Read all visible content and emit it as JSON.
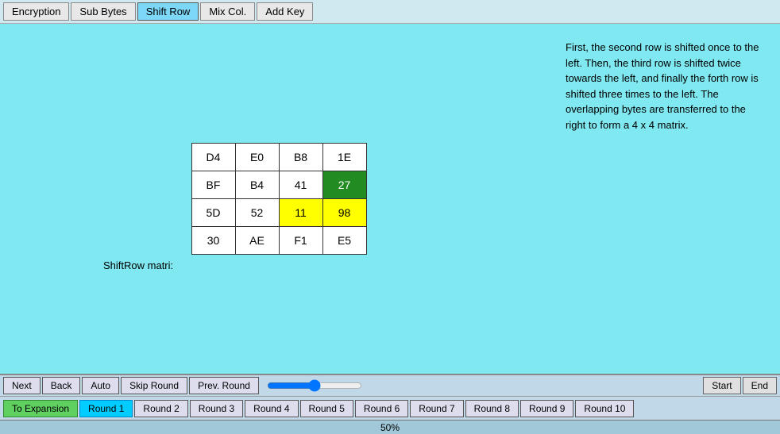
{
  "tabs": [
    {
      "label": "Encryption",
      "active": false
    },
    {
      "label": "Sub Bytes",
      "active": false
    },
    {
      "label": "Shift Row",
      "active": true
    },
    {
      "label": "Mix Col.",
      "active": false
    },
    {
      "label": "Add Key",
      "active": false
    }
  ],
  "matrix": {
    "rows": [
      [
        {
          "val": "D4",
          "style": ""
        },
        {
          "val": "E0",
          "style": ""
        },
        {
          "val": "B8",
          "style": ""
        },
        {
          "val": "1E",
          "style": ""
        }
      ],
      [
        {
          "val": "BF",
          "style": ""
        },
        {
          "val": "B4",
          "style": ""
        },
        {
          "val": "41",
          "style": ""
        },
        {
          "val": "27",
          "style": "cell-green-dark"
        }
      ],
      [
        {
          "val": "5D",
          "style": ""
        },
        {
          "val": "52",
          "style": ""
        },
        {
          "val": "11",
          "style": "cell-yellow"
        },
        {
          "val": "98",
          "style": "cell-yellow2"
        }
      ],
      [
        {
          "val": "30",
          "style": ""
        },
        {
          "val": "AE",
          "style": ""
        },
        {
          "val": "F1",
          "style": ""
        },
        {
          "val": "E5",
          "style": ""
        }
      ]
    ],
    "label": "ShiftRow matri:"
  },
  "description": "First, the second row is shifted once to the left. Then, the third row is shifted twice towards the left, and finally the forth row is shifted three times to the left. The overlapping bytes are transferred to the right to form a 4 x 4 matrix.",
  "nav": {
    "row1_buttons": [
      {
        "label": "Next",
        "name": "next-button"
      },
      {
        "label": "Back",
        "name": "back-button"
      },
      {
        "label": "Auto",
        "name": "auto-button"
      },
      {
        "label": "Skip Round",
        "name": "skip-round-button"
      },
      {
        "label": "Prev. Round",
        "name": "prev-round-button"
      }
    ],
    "start_label": "Start",
    "end_label": "End",
    "row2_buttons": [
      {
        "label": "To Expansion",
        "name": "to-expansion-button",
        "style": "to-expansion"
      },
      {
        "label": "Round 1",
        "name": "round-1-button",
        "active": true
      },
      {
        "label": "Round 2",
        "name": "round-2-button"
      },
      {
        "label": "Round 3",
        "name": "round-3-button"
      },
      {
        "label": "Round 4",
        "name": "round-4-button"
      },
      {
        "label": "Round 5",
        "name": "round-5-button"
      },
      {
        "label": "Round 6",
        "name": "round-6-button"
      },
      {
        "label": "Round 7",
        "name": "round-7-button"
      },
      {
        "label": "Round 8",
        "name": "round-8-button"
      },
      {
        "label": "Round 9",
        "name": "round-9-button"
      },
      {
        "label": "Round 10",
        "name": "round-10-button"
      }
    ]
  },
  "status": {
    "text": "50%"
  }
}
